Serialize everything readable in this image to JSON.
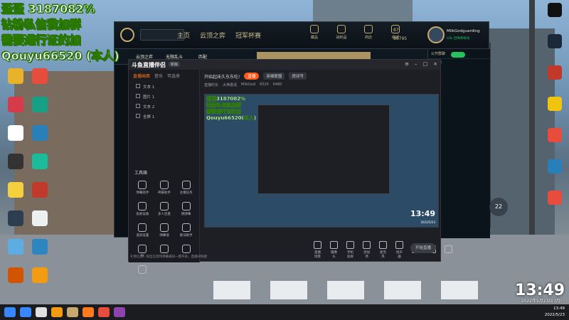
{
  "overlay": {
    "lines": [
      "歪歪 3187082%",
      "钻粉私信我加群",
      "需要通行证的加",
      "Qouyu66520 (本人)"
    ]
  },
  "desktop": {
    "left_icons": [
      {
        "label": "",
        "color": "#e9b22b"
      },
      {
        "label": "",
        "color": "#d73a49"
      },
      {
        "label": "",
        "color": "#ffffff"
      },
      {
        "label": "",
        "color": "#333333"
      },
      {
        "label": "",
        "color": "#f4d03f"
      },
      {
        "label": "",
        "color": "#2c3e50"
      },
      {
        "label": "",
        "color": "#5dade2"
      },
      {
        "label": "",
        "color": "#d35400"
      },
      {
        "label": "",
        "color": "#e74c3c"
      },
      {
        "label": "",
        "color": "#16a085"
      },
      {
        "label": "",
        "color": "#2980b9"
      },
      {
        "label": "",
        "color": "#1abc9c"
      },
      {
        "label": "",
        "color": "#c0392b"
      },
      {
        "label": "",
        "color": "#ecf0f1"
      },
      {
        "label": "",
        "color": "#2e86c1"
      },
      {
        "label": "",
        "color": "#f39c12"
      }
    ],
    "right_icons": [
      {
        "label": "",
        "color": "#111111"
      },
      {
        "label": "",
        "color": "#1b2838"
      },
      {
        "label": "",
        "color": "#c0392b"
      },
      {
        "label": "",
        "color": "#f1c40f"
      },
      {
        "label": "",
        "color": "#e74c3c"
      },
      {
        "label": "",
        "color": "#2980b9"
      },
      {
        "label": "",
        "color": "#e74c3c"
      }
    ],
    "clock": "13:49",
    "date": "2022年5月23日 (月)",
    "gauge_value": "22"
  },
  "lol": {
    "search_placeholder": "",
    "nav": [
      "主页",
      "云顶之弈",
      "冠军杯赛"
    ],
    "tools": [
      "藏品",
      "战利品",
      "商店",
      "商城"
    ],
    "currency_rp": "87",
    "currency_be": "86795",
    "profile_name": "MilkGodguarding",
    "profile_status": "LOL·召唤师峡谷",
    "modes": [
      "云顶之弈",
      "无限乱斗",
      "匹配"
    ],
    "social_header": "公开群聊",
    "social_group": "(3/35)"
  },
  "app": {
    "logo": "斗鱼直播伴侣",
    "badge": "新版",
    "tabs": [
      "直播画面",
      "音乐",
      "可选来"
    ],
    "scenes": [
      "文本 1",
      "图片 1",
      "文本 2",
      "全屏 1"
    ],
    "toolbar": {
      "title": "开始起床久东东吃!",
      "live_pill": "直播",
      "category": "英雄联盟",
      "id_label": "房间号"
    },
    "stats": [
      "直播时长",
      "大神邀请",
      "MilkGod",
      "6520",
      "6480"
    ],
    "tools_title": "工具箱",
    "tools": [
      "弹幕助手",
      "神豪助手",
      "主播任务",
      "投屏设备",
      "多人连麦",
      "跳弹幕",
      "道具设置",
      "弹幕墙",
      "歌词助手",
      "PK",
      "",
      "",
      ""
    ],
    "bottom": [
      "直播场景",
      "摄像头",
      "手机投屏",
      "添加项",
      "麦克风",
      "扬声器",
      "",
      "",
      ""
    ],
    "start_button": "开始直播",
    "notice": "礼物信息、粉丝信息和弹幕通知一键开关，直播间快捷",
    "preview_clock": "13:49",
    "preview_date": "2022/5/23",
    "preview_text": [
      "歪歪3187082%",
      "钻粉私信我加群",
      "需要通行证的加",
      "Qouyu66520(本人)"
    ]
  },
  "taskbar": {
    "time": "13:49",
    "date": "2022/5/23",
    "items": [
      "#3a86ff",
      "#e0e0e0",
      "#f39c12",
      "#c8aa6e",
      "#ff7a1a",
      "#e74c3c",
      "#8e44ad"
    ]
  }
}
